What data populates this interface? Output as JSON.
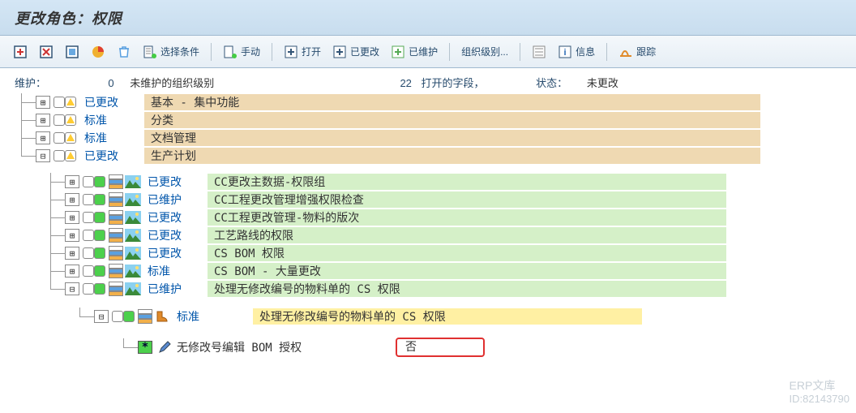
{
  "title": "更改角色：权限",
  "toolbar": {
    "select_cond": "选择条件",
    "manual": "手动",
    "open": "打开",
    "changed": "已更改",
    "maintained": "已维护",
    "org_level": "组织级别...",
    "info": "信息",
    "trace": "跟踪"
  },
  "status_line": {
    "maintain": "维护：",
    "count0": "0",
    "unmaintained_org": "未维护的组织级别",
    "open_count": "22",
    "open_field": "打开的字段，",
    "status_label": "状态：",
    "unchanged": "未更改"
  },
  "tree": {
    "top_nodes": [
      {
        "status": "已更改",
        "desc": "基本 - 集中功能"
      },
      {
        "status": "标准",
        "desc": "分类"
      },
      {
        "status": "标准",
        "desc": "文档管理"
      },
      {
        "status": "已更改",
        "desc": "生产计划"
      }
    ],
    "sub_nodes": [
      {
        "status": "已更改",
        "desc": "CC更改主数据-权限组"
      },
      {
        "status": "已维护",
        "desc": "CC工程更改管理增强权限检查"
      },
      {
        "status": "已更改",
        "desc": "CC工程更改管理-物料的版次"
      },
      {
        "status": "已更改",
        "desc": "工艺路线的权限"
      },
      {
        "status": "已更改",
        "desc": "CS BOM 权限"
      },
      {
        "status": "标准",
        "desc": "CS BOM - 大量更改"
      },
      {
        "status": "已维护",
        "desc": "处理无修改编号的物料单的 CS 权限"
      }
    ],
    "auth_node": {
      "status": "标准",
      "desc": "处理无修改编号的物料单的 CS 权限"
    },
    "field": {
      "label": "无修改号编辑 BOM 授权",
      "value": "否"
    }
  },
  "watermark": {
    "l1": "ERP文库",
    "l2": "ID:82143790"
  }
}
